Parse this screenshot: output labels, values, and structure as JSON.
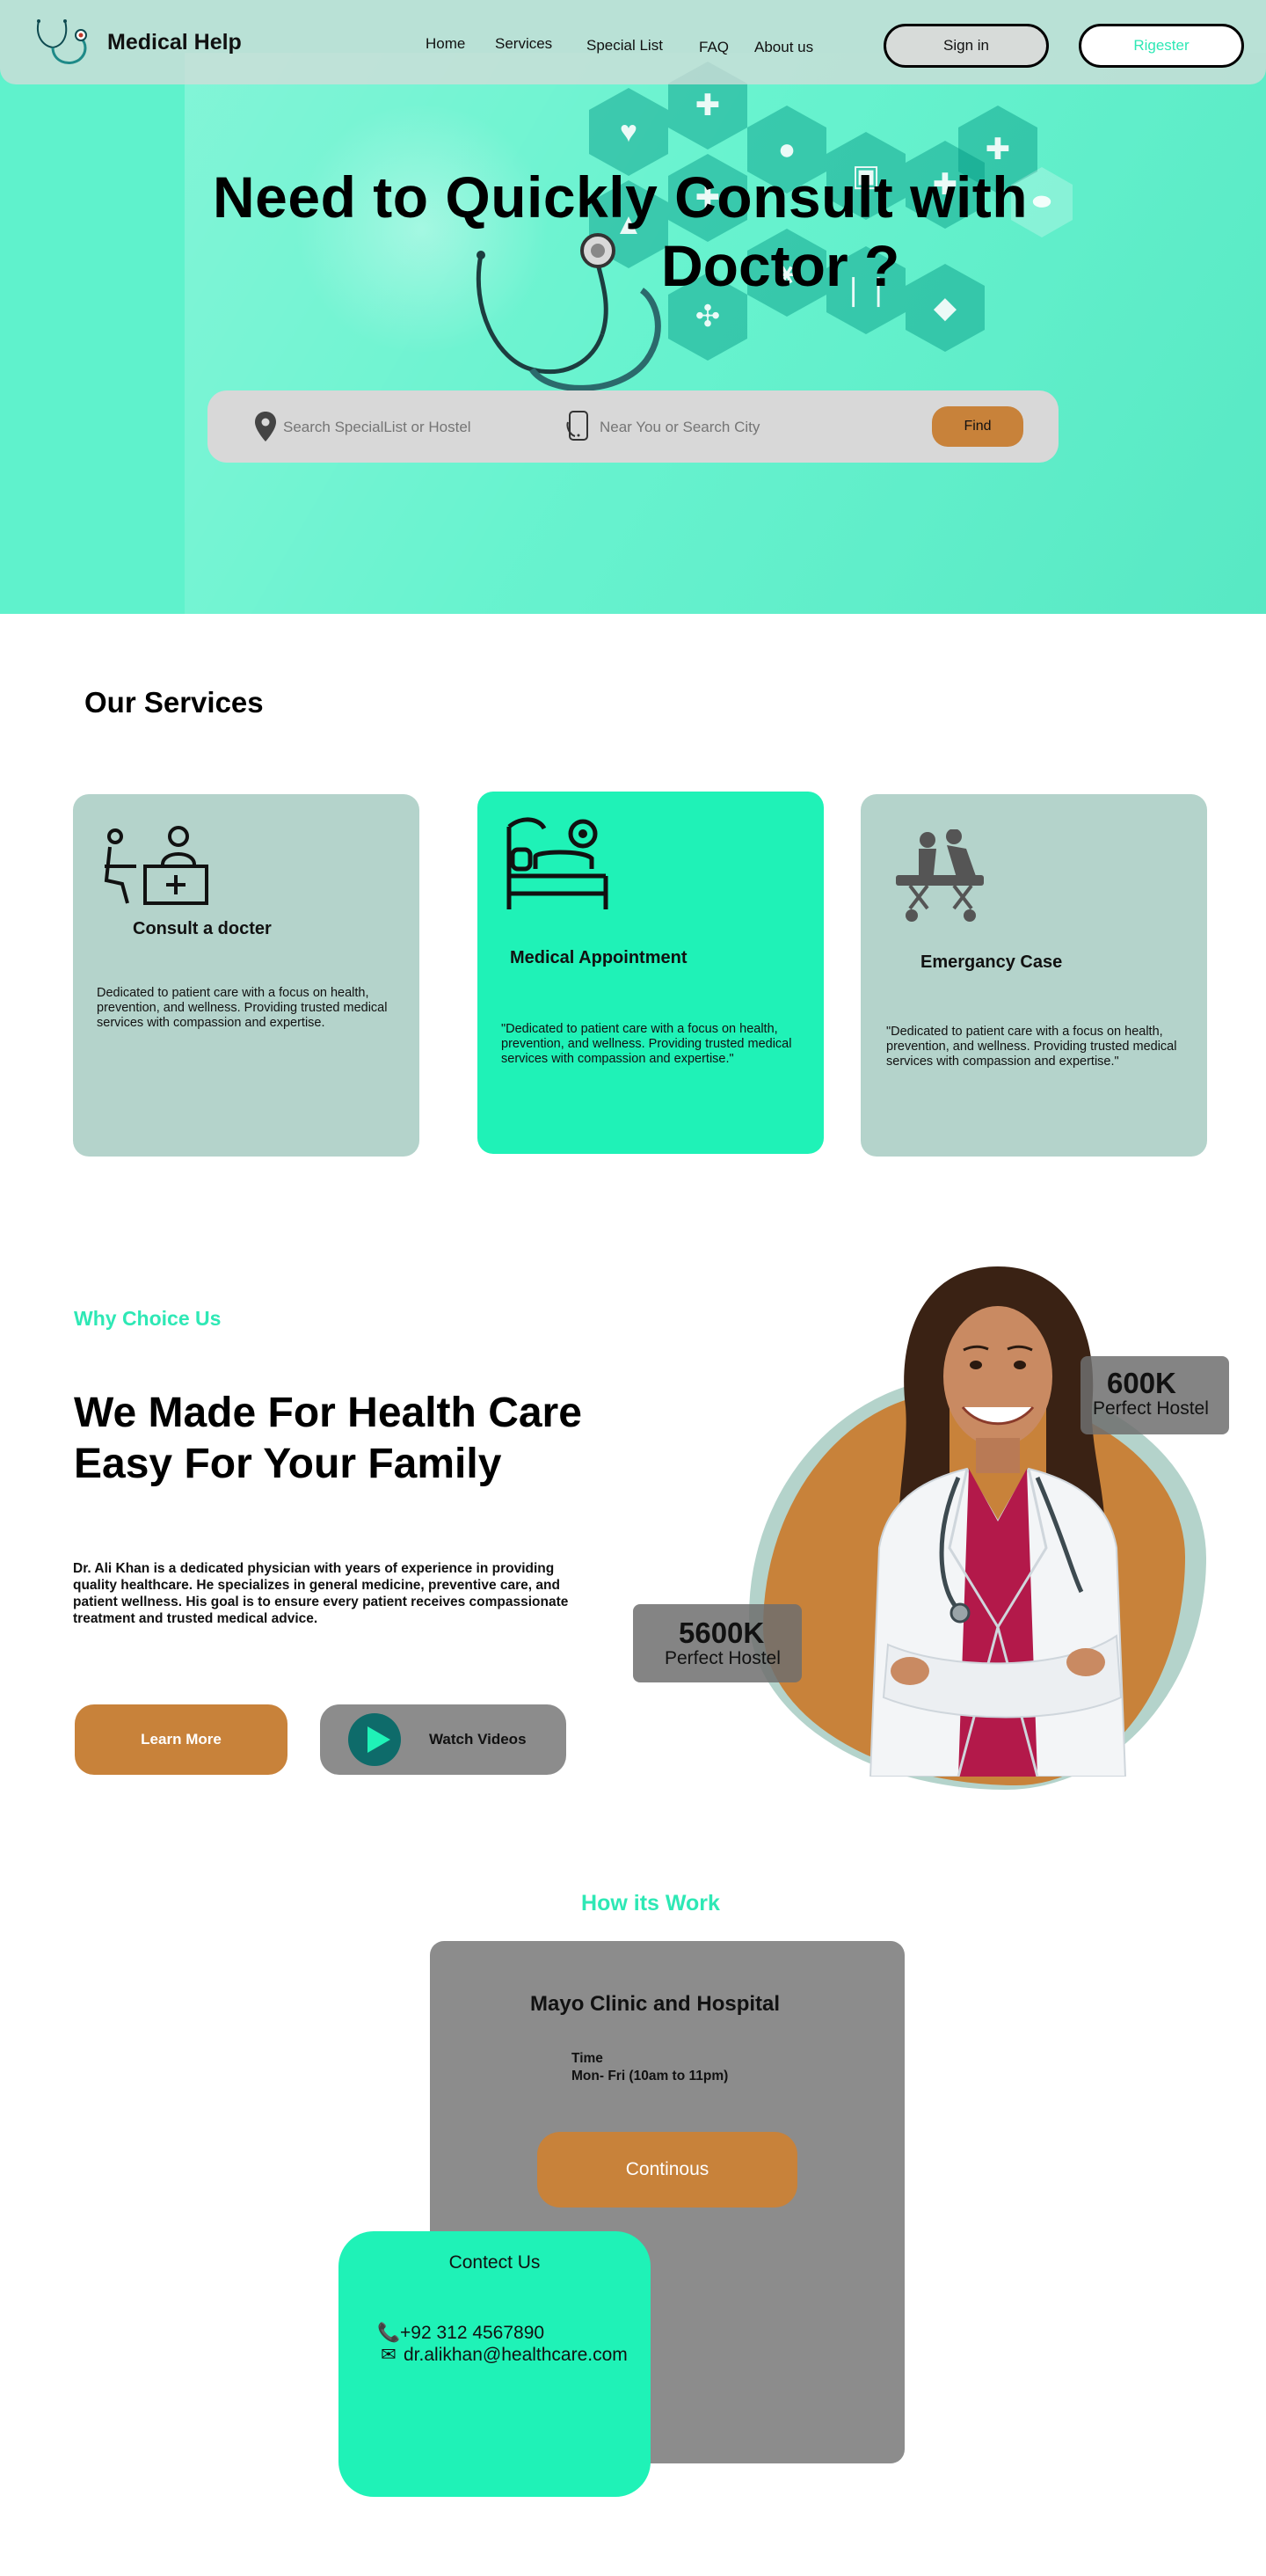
{
  "brand": {
    "name": "Medical Help"
  },
  "nav": {
    "links": [
      "Home",
      "Services",
      "Special List",
      "FAQ",
      "About us"
    ],
    "signin_label": "Sign in",
    "register_label": "Rigester"
  },
  "hero": {
    "title_line1": "Need  to Quickly Consult with",
    "title_line2": "Doctor ?",
    "search": {
      "specialist_placeholder": "Search SpecialList or Hostel",
      "city_placeholder": "Near You or Search City",
      "find_label": "Find"
    }
  },
  "services": {
    "title": "Our Services",
    "cards": [
      {
        "title": "Consult a docter",
        "description": "Dedicated to patient care with a focus on health, prevention, and wellness. Providing trusted medical services with compassion and expertise."
      },
      {
        "title": "Medical Appointment",
        "description": "\"Dedicated to patient care with a focus on health, prevention, and wellness. Providing trusted medical services with compassion and expertise.\""
      },
      {
        "title": "Emergancy Case",
        "description": "\"Dedicated to patient care with a focus on health, prevention, and wellness. Providing trusted medical services with compassion and expertise.\""
      }
    ]
  },
  "why": {
    "label": "Why Choice Us",
    "title": "We Made For Health Care Easy For Your Family",
    "description": "Dr. Ali Khan is a dedicated physician with years of experience in providing quality healthcare. He specializes in general medicine, preventive care, and patient wellness. His goal is to ensure every patient receives compassionate treatment and trusted medical advice.",
    "learn_more_label": "Learn More",
    "watch_label": "Watch Videos",
    "stats": [
      {
        "value": "600K",
        "label": "Perfect  Hostel"
      },
      {
        "value": "5600K",
        "label": "Perfect  Hostel"
      }
    ]
  },
  "how": {
    "label": "How its Work",
    "clinic_name": "Mayo Clinic and Hospital",
    "time_label": "Time",
    "time_value": "Mon- Fri (10am  to 11pm)",
    "continue_label": "Continous",
    "contact": {
      "title": "Contect Us",
      "phone": "+92 312 4567890",
      "email": "dr.alikhan@healthcare.com"
    }
  },
  "colors": {
    "hero_bg": "#5ff2cc",
    "accent_green": "#1ff2b7",
    "accent_text_green": "#2ee8b5",
    "card_grey": "#b4d3cb",
    "orange": "#c8823a",
    "dark_grey": "#8c8c8c"
  },
  "icons": [
    "stethoscope-logo-icon",
    "location-pin-icon",
    "phone-icon",
    "consult-doctor-icon",
    "appointment-bed-icon",
    "emergency-stretcher-icon",
    "play-icon",
    "telephone-icon",
    "email-icon"
  ]
}
